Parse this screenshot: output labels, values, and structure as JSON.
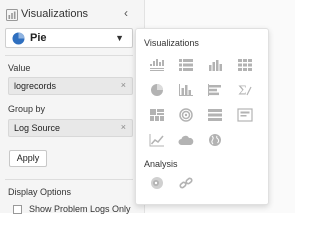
{
  "panel": {
    "title": "Visualizations",
    "chart_type_selected": "Pie",
    "value_label": "Value",
    "value_chip": "logrecords",
    "group_by_label": "Group by",
    "group_by_chip": "Log Source",
    "apply_label": "Apply",
    "display_options_title": "Display Options",
    "show_problem_logs_label": "Show Problem Logs Only"
  },
  "popup": {
    "visualizations_title": "Visualizations",
    "analysis_title": "Analysis",
    "visualization_icons": [
      "records-histogram-icon",
      "records-table-icon",
      "bar-histogram-icon",
      "heatmap-table-icon",
      "pie-chart-icon",
      "bar-chart-icon",
      "horizontal-bar-chart-icon",
      "summary-sigma-icon",
      "treemap-icon",
      "sunburst-icon",
      "distinct-rows-icon",
      "tile-icon",
      "line-chart-icon",
      "cloud-icon",
      "map-globe-icon"
    ],
    "analysis_icons": [
      "cluster-analysis-icon",
      "link-analysis-icon"
    ]
  },
  "colors": {
    "icon_gray": "#b3b3b3",
    "selected_icon": "#2f6fbf",
    "panel_bg": "#f5f5f5"
  }
}
